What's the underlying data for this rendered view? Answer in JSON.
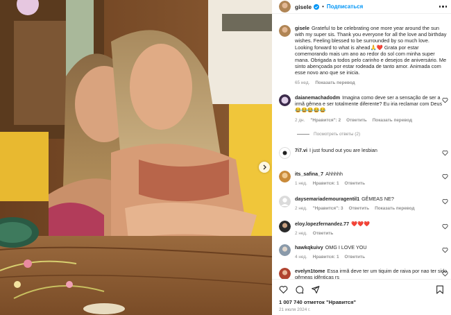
{
  "header": {
    "username": "gisele",
    "separator": "•",
    "follow_label": "Подписаться"
  },
  "caption": {
    "username": "gisele",
    "text": "Grateful to be celebrating one more year around the sun with my super sis. Thank you everyone for all the love and birthday wishes. Feeling blessed to be surrounded by so much love. Looking forward to what is ahead🙏❤️ Grata por estar comemorando mais um ano ao redor do sol com minha super mana. Obrigada a todos pelo carinho e desejos de aniversário. Me sinto abençoada por estar rodeada de tanto amor. Animada com esse novo ano que se inicia.",
    "time": "65 нед.",
    "translate": "Показать перевод"
  },
  "comments": [
    {
      "username": "daianemachadodm",
      "text": "Imagina como deve ser a sensação de ser a irmã gêmea e ser totalmente diferente? Eu iria reclamar com Deus 😂😂😂😂😂",
      "time": "2 дн.",
      "likes": "\"Нравится\": 2",
      "reply": "Ответить",
      "translate": "Показать перевод",
      "replies": "Посмотреть ответы (2)",
      "avatar_color": "#3b2a4a"
    },
    {
      "username": "7i7.vi",
      "text": "I just found out you are lesbian",
      "time": "",
      "likes": "",
      "reply": "",
      "translate": "",
      "avatar_color": "#ffffff"
    },
    {
      "username": "its_safina_7",
      "text": "Ahhhhh",
      "time": "1 нед.",
      "likes": "Нравится: 1",
      "reply": "Ответить",
      "translate": "",
      "avatar_color": "#c98a3a"
    },
    {
      "username": "daysemariademouragentil1",
      "text": "GÊMEAS NE?",
      "time": "2 нед.",
      "likes": "\"Нравится\": 3",
      "reply": "Ответить",
      "translate": "Показать перевод",
      "avatar_color": "#dbdbdb"
    },
    {
      "username": "eloy.lopezfernandez.77",
      "text": "❤️❤️❤️",
      "time": "2 нед.",
      "likes": "",
      "reply": "Ответить",
      "translate": "",
      "avatar_color": "#2a2a2a"
    },
    {
      "username": "hawkqkuivy",
      "text": "OMG I LOVE YOU",
      "time": "4 нед.",
      "likes": "Нравится: 1",
      "reply": "Ответить",
      "translate": "",
      "avatar_color": "#8a9aaa"
    },
    {
      "username": "evelyn1tome",
      "text": "Essa irmã deve ter um tiquim de raiva por nao ter sido gêmeas idênticas rs",
      "time": "",
      "likes": "",
      "reply": "",
      "translate": "",
      "avatar_color": "#b0432f"
    }
  ],
  "actions": {
    "likes_text": "1 007 740 отметок \"Нравится\"",
    "date": "21 июля 2024 г."
  },
  "colors": {
    "link": "#0095f6",
    "verified": "#0095f6",
    "muted": "#8e8e8e",
    "heart": "#ed4956"
  },
  "icons": [
    "verified-badge-icon",
    "more-options-icon",
    "heart-icon",
    "comment-icon",
    "share-icon",
    "bookmark-icon",
    "carousel-next-icon"
  ]
}
